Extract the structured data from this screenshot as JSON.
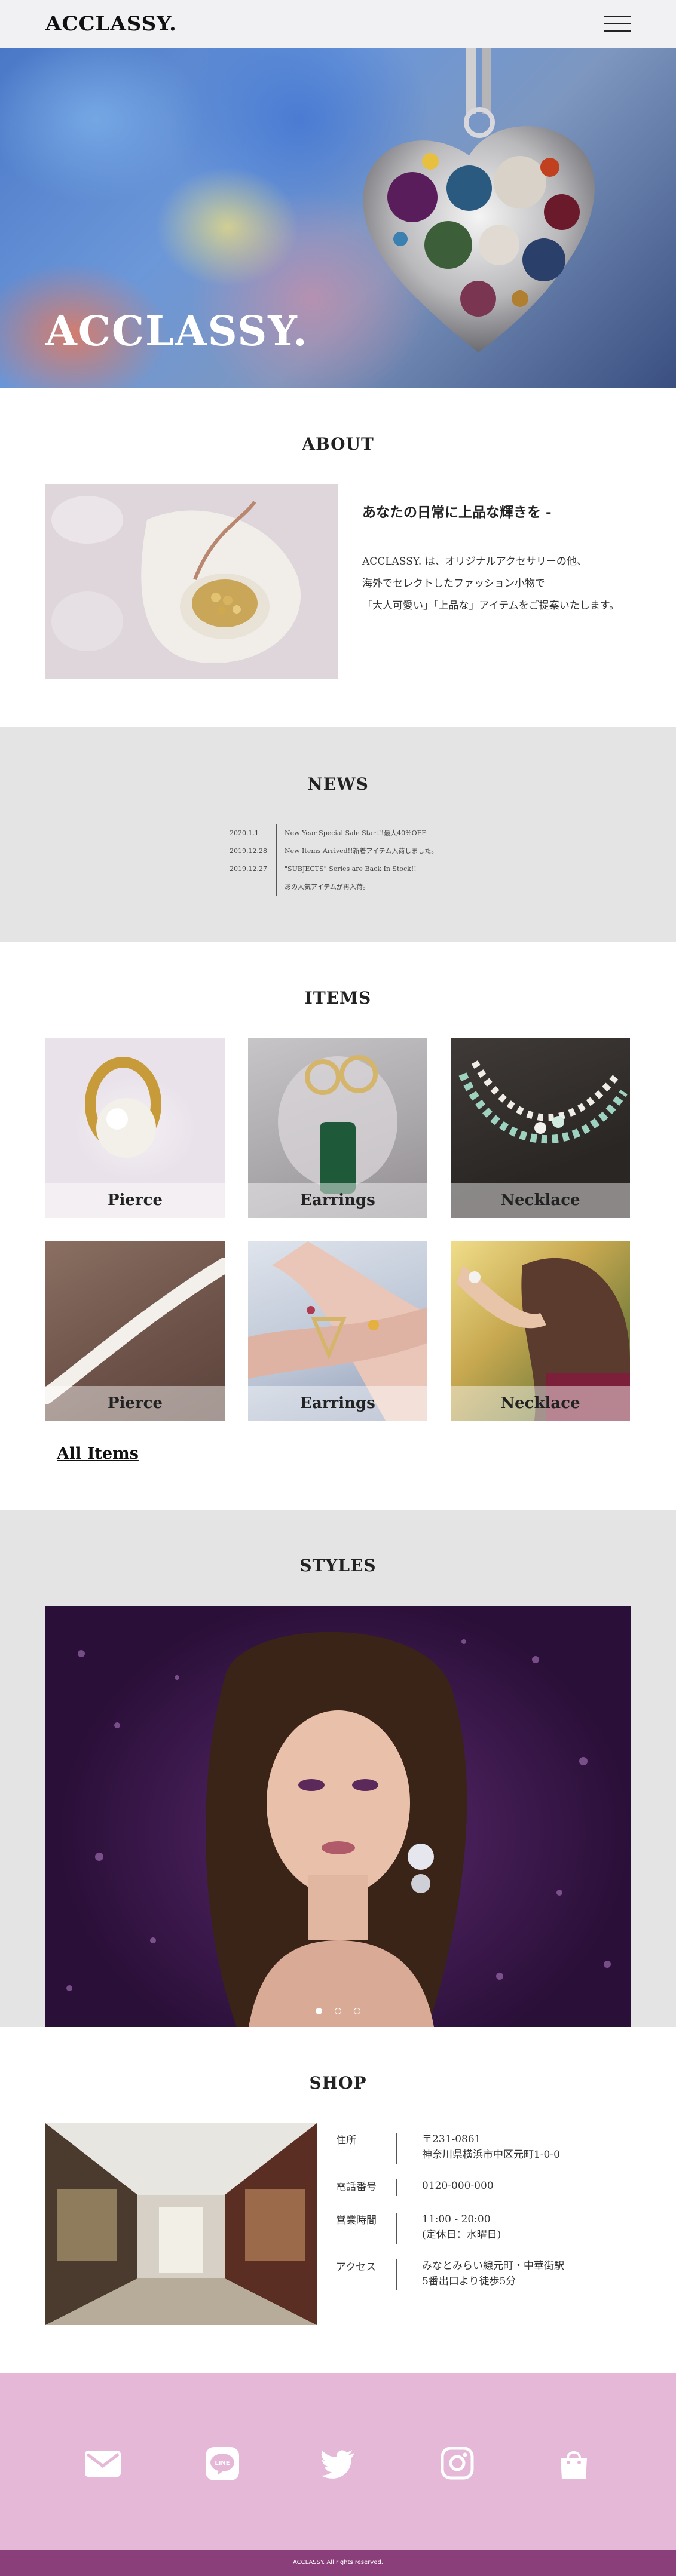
{
  "header": {
    "logo": "ACCLASSY."
  },
  "hero": {
    "title": "ACCLASSY."
  },
  "about": {
    "title": "ABOUT",
    "heading": "あなたの日常に上品な輝きを -",
    "body": "ACCLASSY. は、オリジナルアクセサリーの他、\n海外でセレクトしたファッション小物で\n「大人可愛い」「上品な」アイテムをご提案いたします。"
  },
  "news": {
    "title": "NEWS",
    "items": [
      {
        "date": "2020.1.1",
        "text": "New Year Special Sale Start!!最大40%OFF"
      },
      {
        "date": "2019.12.28",
        "text": "New Items Arrived!!新着アイテム入荷しました。"
      },
      {
        "date": "2019.12.27",
        "text": "\"SUBJECTS\" Series are Back In Stock!!"
      },
      {
        "date": "",
        "text": "あの人気アイテムが再入荷。"
      }
    ]
  },
  "items": {
    "title": "ITEMS",
    "cards": [
      {
        "label": "Pierce"
      },
      {
        "label": "Earrings"
      },
      {
        "label": "Necklace"
      },
      {
        "label": "Pierce"
      },
      {
        "label": "Earrings"
      },
      {
        "label": "Necklace"
      }
    ],
    "all_items": "All Items"
  },
  "styles": {
    "title": "STYLES",
    "slides_total": 3,
    "active_slide": 1
  },
  "shop": {
    "title": "SHOP",
    "rows": [
      {
        "label": "住所",
        "value": "〒231-0861\n神奈川県横浜市中区元町1-0-0"
      },
      {
        "label": "電話番号",
        "value": "0120-000-000"
      },
      {
        "label": "営業時間",
        "value": "11:00 - 20:00\n(定休日：水曜日)"
      },
      {
        "label": "アクセス",
        "value": "みなとみらい線元町・中華街駅\n5番出口より徒歩5分"
      }
    ]
  },
  "footer": {
    "icons": [
      "mail-icon",
      "line-icon",
      "twitter-icon",
      "instagram-icon",
      "shopping-bag-icon"
    ],
    "copyright": "ACCLASSY. All rights reserved."
  },
  "colors": {
    "footer_bg": "#e5b8d8",
    "copyright_bg": "#8a3f7a",
    "section_gray": "#e4e4e4"
  }
}
